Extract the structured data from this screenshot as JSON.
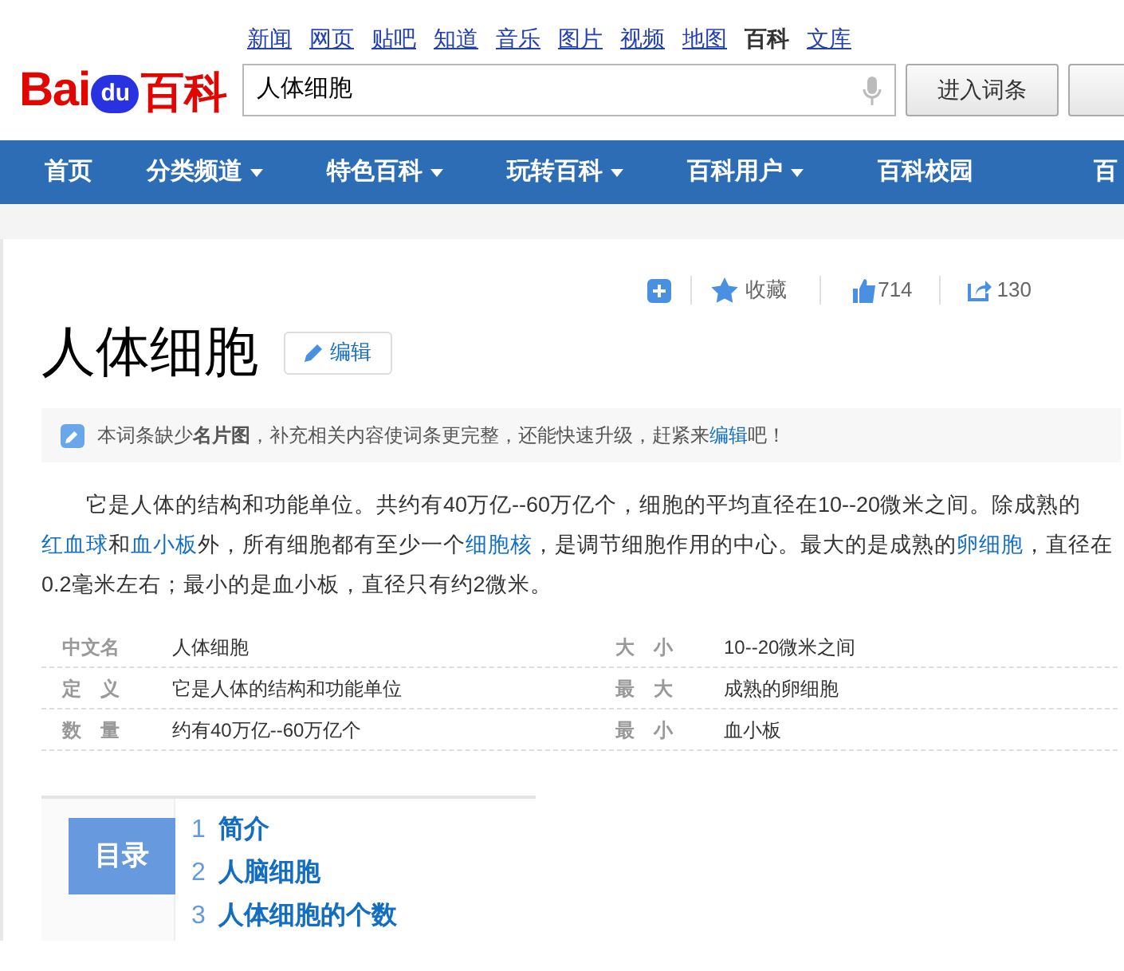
{
  "logo": {
    "part_1": "Bai",
    "part_2": "du",
    "part_3": "百科"
  },
  "top_links": [
    {
      "label": "新闻",
      "selected": false
    },
    {
      "label": "网页",
      "selected": false
    },
    {
      "label": "贴吧",
      "selected": false
    },
    {
      "label": "知道",
      "selected": false
    },
    {
      "label": "音乐",
      "selected": false
    },
    {
      "label": "图片",
      "selected": false
    },
    {
      "label": "视频",
      "selected": false
    },
    {
      "label": "地图",
      "selected": false
    },
    {
      "label": "百科",
      "selected": true
    },
    {
      "label": "文库",
      "selected": false
    }
  ],
  "search": {
    "value": "人体细胞"
  },
  "buttons": [
    "进入词条"
  ],
  "nav": [
    {
      "label": "首页",
      "dropdown": false
    },
    {
      "label": "分类频道",
      "dropdown": true
    },
    {
      "label": "特色百科",
      "dropdown": true
    },
    {
      "label": "玩转百科",
      "dropdown": true
    },
    {
      "label": "百科用户",
      "dropdown": true
    },
    {
      "label": "百科校园",
      "dropdown": false
    },
    {
      "label": "百",
      "dropdown": false
    }
  ],
  "actions": {
    "collect": "收藏",
    "likes": "714",
    "shares": "130"
  },
  "title": "人体细胞",
  "edit_button": "编辑",
  "notice": {
    "text": "本词条缺少**名片图**，补充相关内容使词条更完整，还能快速升级，赶紧来",
    "link": "编辑",
    "end": "吧！"
  },
  "paragraph": [
    {
      "text": "它是人体的结构和功能单位。共约有40万亿--60万亿个，细胞的平均直径在10--20微米之间。除成熟的",
      "link": false
    },
    {
      "text": "红血球",
      "link": true
    },
    {
      "text": "和",
      "link": false
    },
    {
      "text": "血小板",
      "link": true
    },
    {
      "text": "外，所有细胞都有至少一个",
      "link": false
    },
    {
      "text": "细胞核",
      "link": true
    },
    {
      "text": "，是调节细胞作用的中心。最大的是成熟的",
      "link": false
    },
    {
      "text": "卵细胞",
      "link": true
    },
    {
      "text": "，直径在0.2毫米左右；最小的是血小板，直径只有约2微米。",
      "link": false
    }
  ],
  "infobox": [
    {
      "label": "中文名",
      "value": "人体细胞",
      "label_2": "大　小",
      "value_2": "10--20微米之间"
    },
    {
      "label": "定　义",
      "value": "它是人体的结构和功能单位",
      "label_2": "最　大",
      "value_2": "成熟的卵细胞"
    },
    {
      "label": "数　量",
      "value": "约有40万亿--60万亿个",
      "label_2": "最　小",
      "value_2": "血小板"
    }
  ],
  "toc": {
    "heading": "目录",
    "items": [
      {
        "number": "1",
        "label": "简介"
      },
      {
        "number": "2",
        "label": "人脑细胞"
      },
      {
        "number": "3",
        "label": "人体细胞的个数"
      }
    ]
  }
}
